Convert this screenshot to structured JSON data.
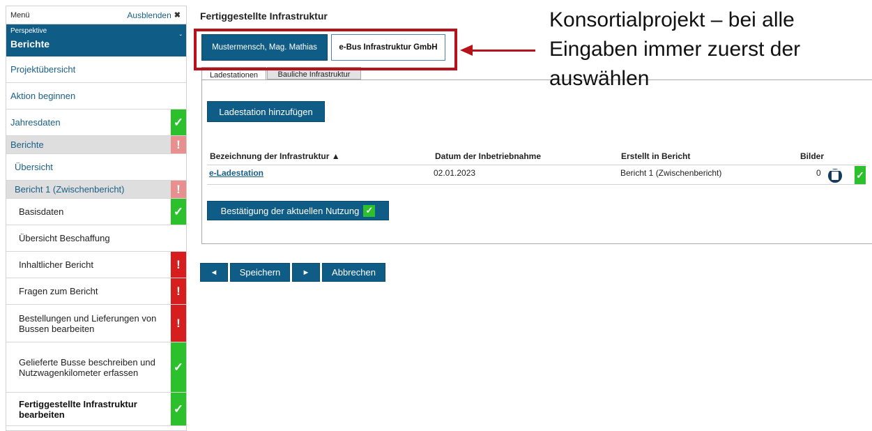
{
  "sidebar": {
    "menu_label": "Menü",
    "hide_label": "Ausblenden",
    "hide_icon": "close-icon",
    "perspective_caption": "Perspektive",
    "perspective_value": "Berichte",
    "items": [
      {
        "label": "Projektübersicht",
        "status": null
      },
      {
        "label": "Aktion beginnen",
        "status": null
      },
      {
        "label": "Jahresdaten",
        "status": "ok"
      },
      {
        "label": "Berichte",
        "status": "error"
      },
      {
        "label": "Übersicht",
        "status": null
      },
      {
        "label": "Bericht 1 (Zwischenbericht)",
        "status": "error"
      },
      {
        "label": "Basisdaten",
        "status": "ok"
      },
      {
        "label": "Übersicht Beschaffung",
        "status": null
      },
      {
        "label": "Inhaltlicher Bericht",
        "status": "error"
      },
      {
        "label": "Fragen zum Bericht",
        "status": "error"
      },
      {
        "label": "Bestellungen und Lieferungen von Bussen bearbeiten",
        "status": "error"
      },
      {
        "label": "Gelieferte Busse beschreiben und Nutzwagenkilometer erfassen",
        "status": "ok"
      },
      {
        "label": "Fertiggestellte Infrastruktur bearbeiten",
        "status": "ok"
      }
    ],
    "status_symbols": {
      "ok": "✓",
      "error": "!"
    }
  },
  "main": {
    "title": "Fertiggestellte Infrastruktur",
    "person_button": "Mustermensch, Mag. Mathias",
    "company_button": "e-Bus Infrastruktur GmbH",
    "tabs": [
      {
        "label": "Ladestationen",
        "active": true
      },
      {
        "label": "Bauliche Infrastruktur",
        "active": false
      }
    ],
    "add_button": "Ladestation hinzufügen",
    "table": {
      "columns": [
        "Bezeichnung der Infrastruktur ▲",
        "Datum der Inbetriebnahme",
        "Erstellt in Bericht",
        "Bilder"
      ],
      "rows": [
        {
          "name": "e-Ladestation",
          "date": "02.01.2023",
          "report": "Bericht 1 (Zwischenbericht)",
          "images": "0"
        }
      ]
    },
    "confirm_button": "Bestätigung der aktuellen Nutzung",
    "footer": {
      "prev": "◄",
      "save": "Speichern",
      "next": "►",
      "cancel": "Abbrechen"
    }
  },
  "annotation": {
    "lines": [
      "Konsortialprojekt – bei alle",
      "Eingaben immer zuerst der",
      "auswählen"
    ],
    "color": "#b5121b"
  },
  "colors": {
    "primary": "#0f5c86",
    "ok": "#2cc12c",
    "error": "#d71e1e"
  }
}
